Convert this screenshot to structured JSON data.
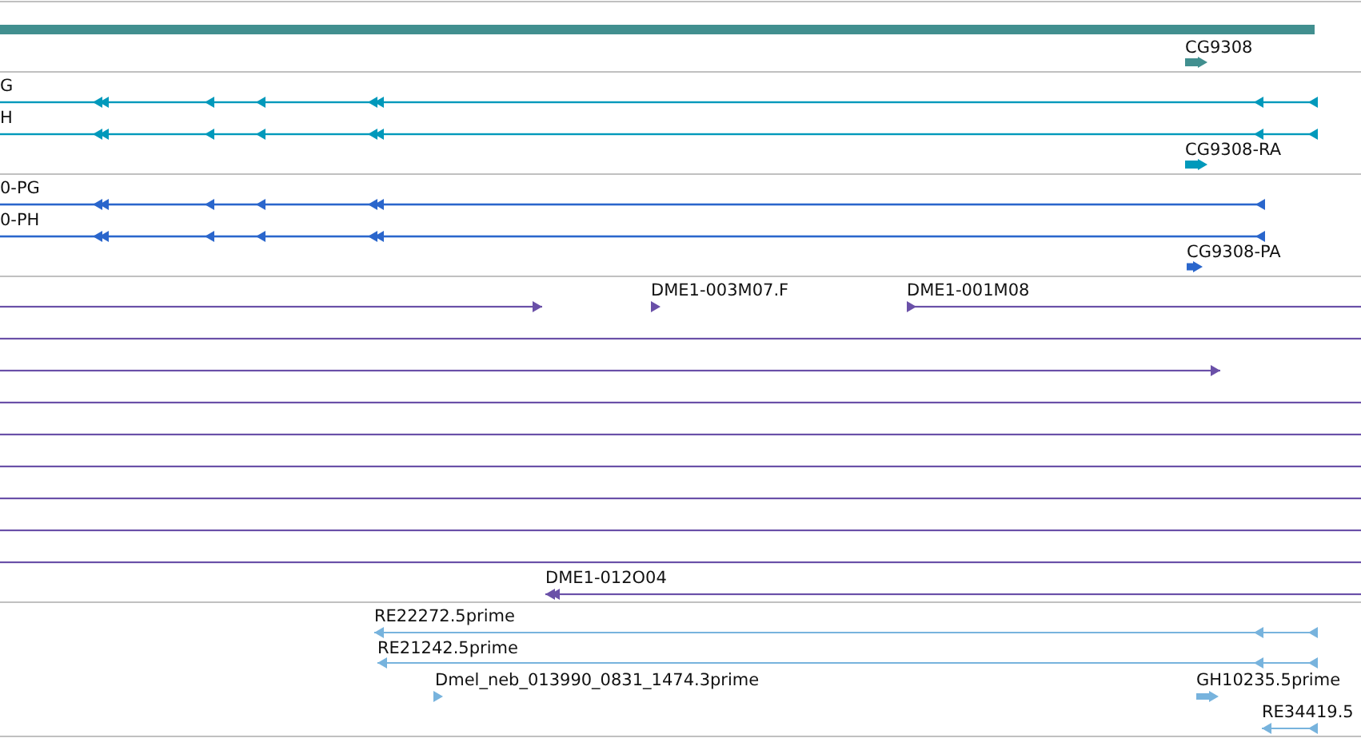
{
  "tracks": [
    {
      "kind": "gene",
      "color": "#418f8f",
      "features": [
        {
          "label": "CG9308",
          "reverse": false
        }
      ]
    },
    {
      "kind": "transcript",
      "color": "#0099bb",
      "features": [
        {
          "label": "G",
          "reverse": true
        },
        {
          "label": "H",
          "reverse": true
        },
        {
          "label": "CG9308-RA",
          "reverse": false
        }
      ]
    },
    {
      "kind": "protein",
      "color": "#2a66cc",
      "features": [
        {
          "label": "0-PG",
          "reverse": true
        },
        {
          "label": "0-PH",
          "reverse": true
        },
        {
          "label": "CG9308-PA",
          "reverse": false
        }
      ]
    },
    {
      "kind": "clone",
      "color": "#6a50a8",
      "features": [
        {
          "label": "DME1-003M07.F",
          "reverse": false
        },
        {
          "label": "DME1-001M08",
          "reverse": false
        },
        {
          "label": "DME1-012O04",
          "reverse": true
        }
      ]
    },
    {
      "kind": "est",
      "color": "#77b3dd",
      "features": [
        {
          "label": "RE22272.5prime",
          "reverse": true
        },
        {
          "label": "RE21242.5prime",
          "reverse": true
        },
        {
          "label": "Dmel_neb_013990_0831_1474.3prime",
          "reverse": false
        },
        {
          "label": "GH10235.5prime",
          "reverse": false
        },
        {
          "label": "RE34419.5",
          "reverse": true
        }
      ]
    }
  ]
}
